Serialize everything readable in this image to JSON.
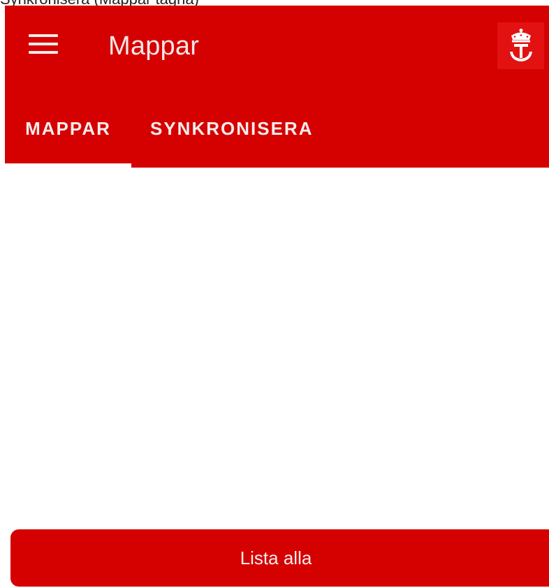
{
  "app": {
    "title": "Mappar"
  },
  "top_strip": {
    "text": "Synkronisera (Mappar tagna)"
  },
  "tabs": [
    {
      "label": "MAPPAR",
      "selected": true
    },
    {
      "label": "SYNKRONISERA",
      "selected": false
    }
  ],
  "actions": {
    "list_all_label": "Lista alla"
  },
  "icons": {
    "menu": "hamburger-menu-icon",
    "logo": "crown-emblem-logo"
  },
  "colors": {
    "primary": "#d50000",
    "logo_bg": "#e21212",
    "on_primary": "#f4e6e6",
    "background": "#ffffff"
  }
}
